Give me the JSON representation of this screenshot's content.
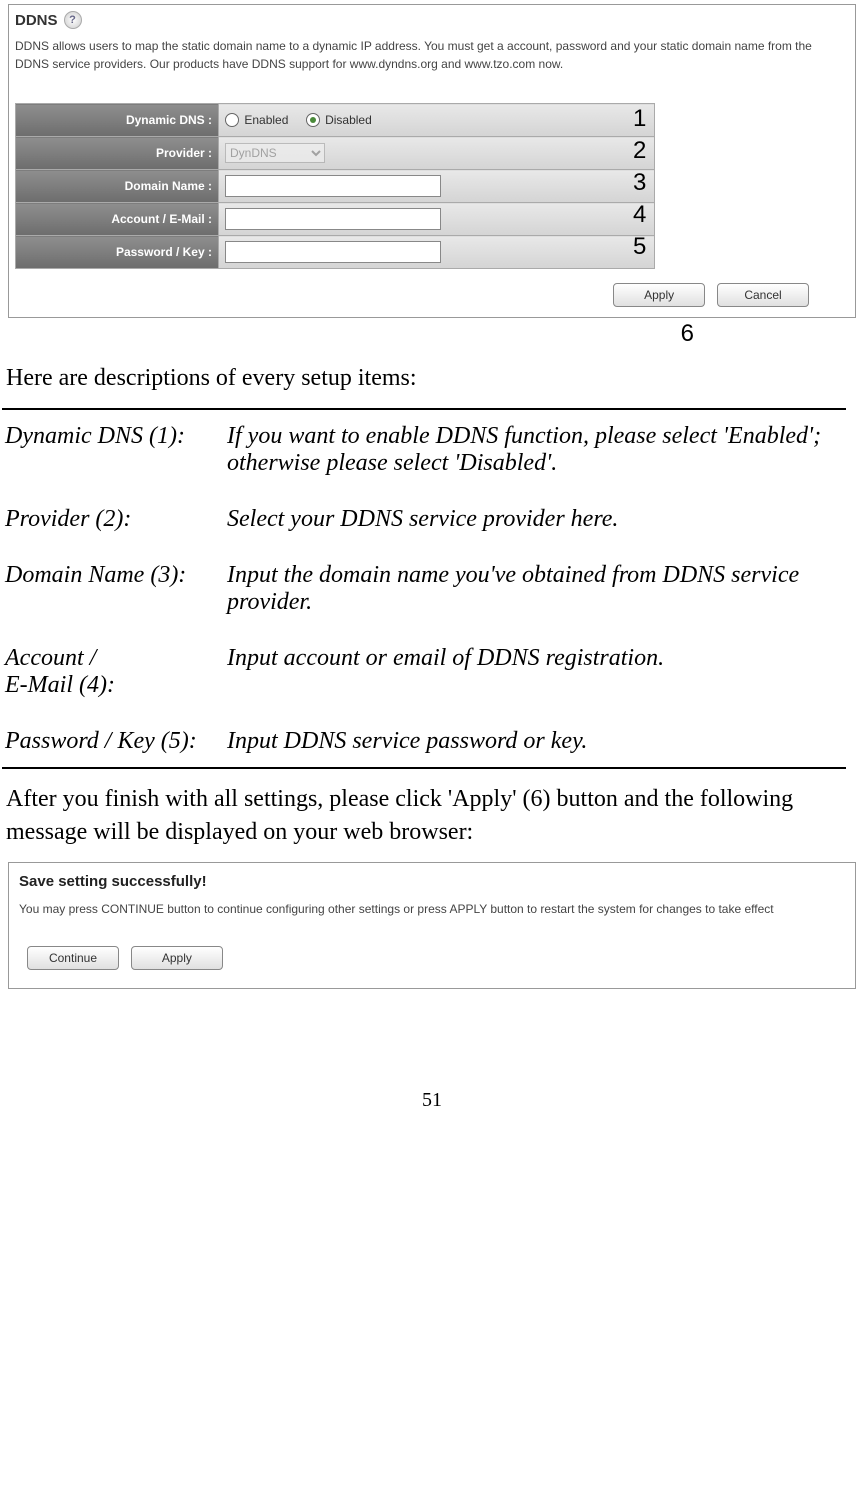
{
  "ddns_panel": {
    "title": "DDNS",
    "help_glyph": "?",
    "description": "DDNS allows users to map the static domain name to a dynamic IP address. You must get a account, password and your static domain name from the DDNS service providers. Our products have DDNS support for www.dyndns.org and www.tzo.com now.",
    "rows": {
      "dynamic_dns_label": "Dynamic DNS :",
      "enabled_label": "Enabled",
      "disabled_label": "Disabled",
      "provider_label": "Provider :",
      "provider_value": "DynDNS",
      "domain_label": "Domain Name :",
      "account_label": "Account / E-Mail :",
      "password_label": "Password / Key :"
    },
    "buttons": {
      "apply": "Apply",
      "cancel": "Cancel"
    },
    "annotations": {
      "a1": "1",
      "a2": "2",
      "a3": "3",
      "a4": "4",
      "a5": "5",
      "a6": "6"
    }
  },
  "intro_line": "Here are descriptions of every setup items:",
  "desc": {
    "r1l": "Dynamic DNS (1):",
    "r1r": "If you want to enable DDNS function, please select 'Enabled'; otherwise please select 'Disabled'.",
    "r2l": "Provider (2):",
    "r2r": "Select your DDNS service provider here.",
    "r3l": "Domain Name (3):",
    "r3r": "Input the domain name you've obtained from DDNS service provider.",
    "r4l1": "Account /",
    "r4l2": "E-Mail (4):",
    "r4r": "Input account or email of DDNS registration.",
    "r5l": "Password / Key (5):",
    "r5r": "Input DDNS service password or key."
  },
  "after_text": "After you finish with all settings, please click 'Apply' (6) button and the following message will be displayed on your web browser:",
  "save_panel": {
    "title": "Save setting successfully!",
    "desc": "You may press CONTINUE button to continue configuring other settings or press APPLY button to restart the system for changes to take effect",
    "continue_btn": "Continue",
    "apply_btn": "Apply"
  },
  "page_number": "51"
}
